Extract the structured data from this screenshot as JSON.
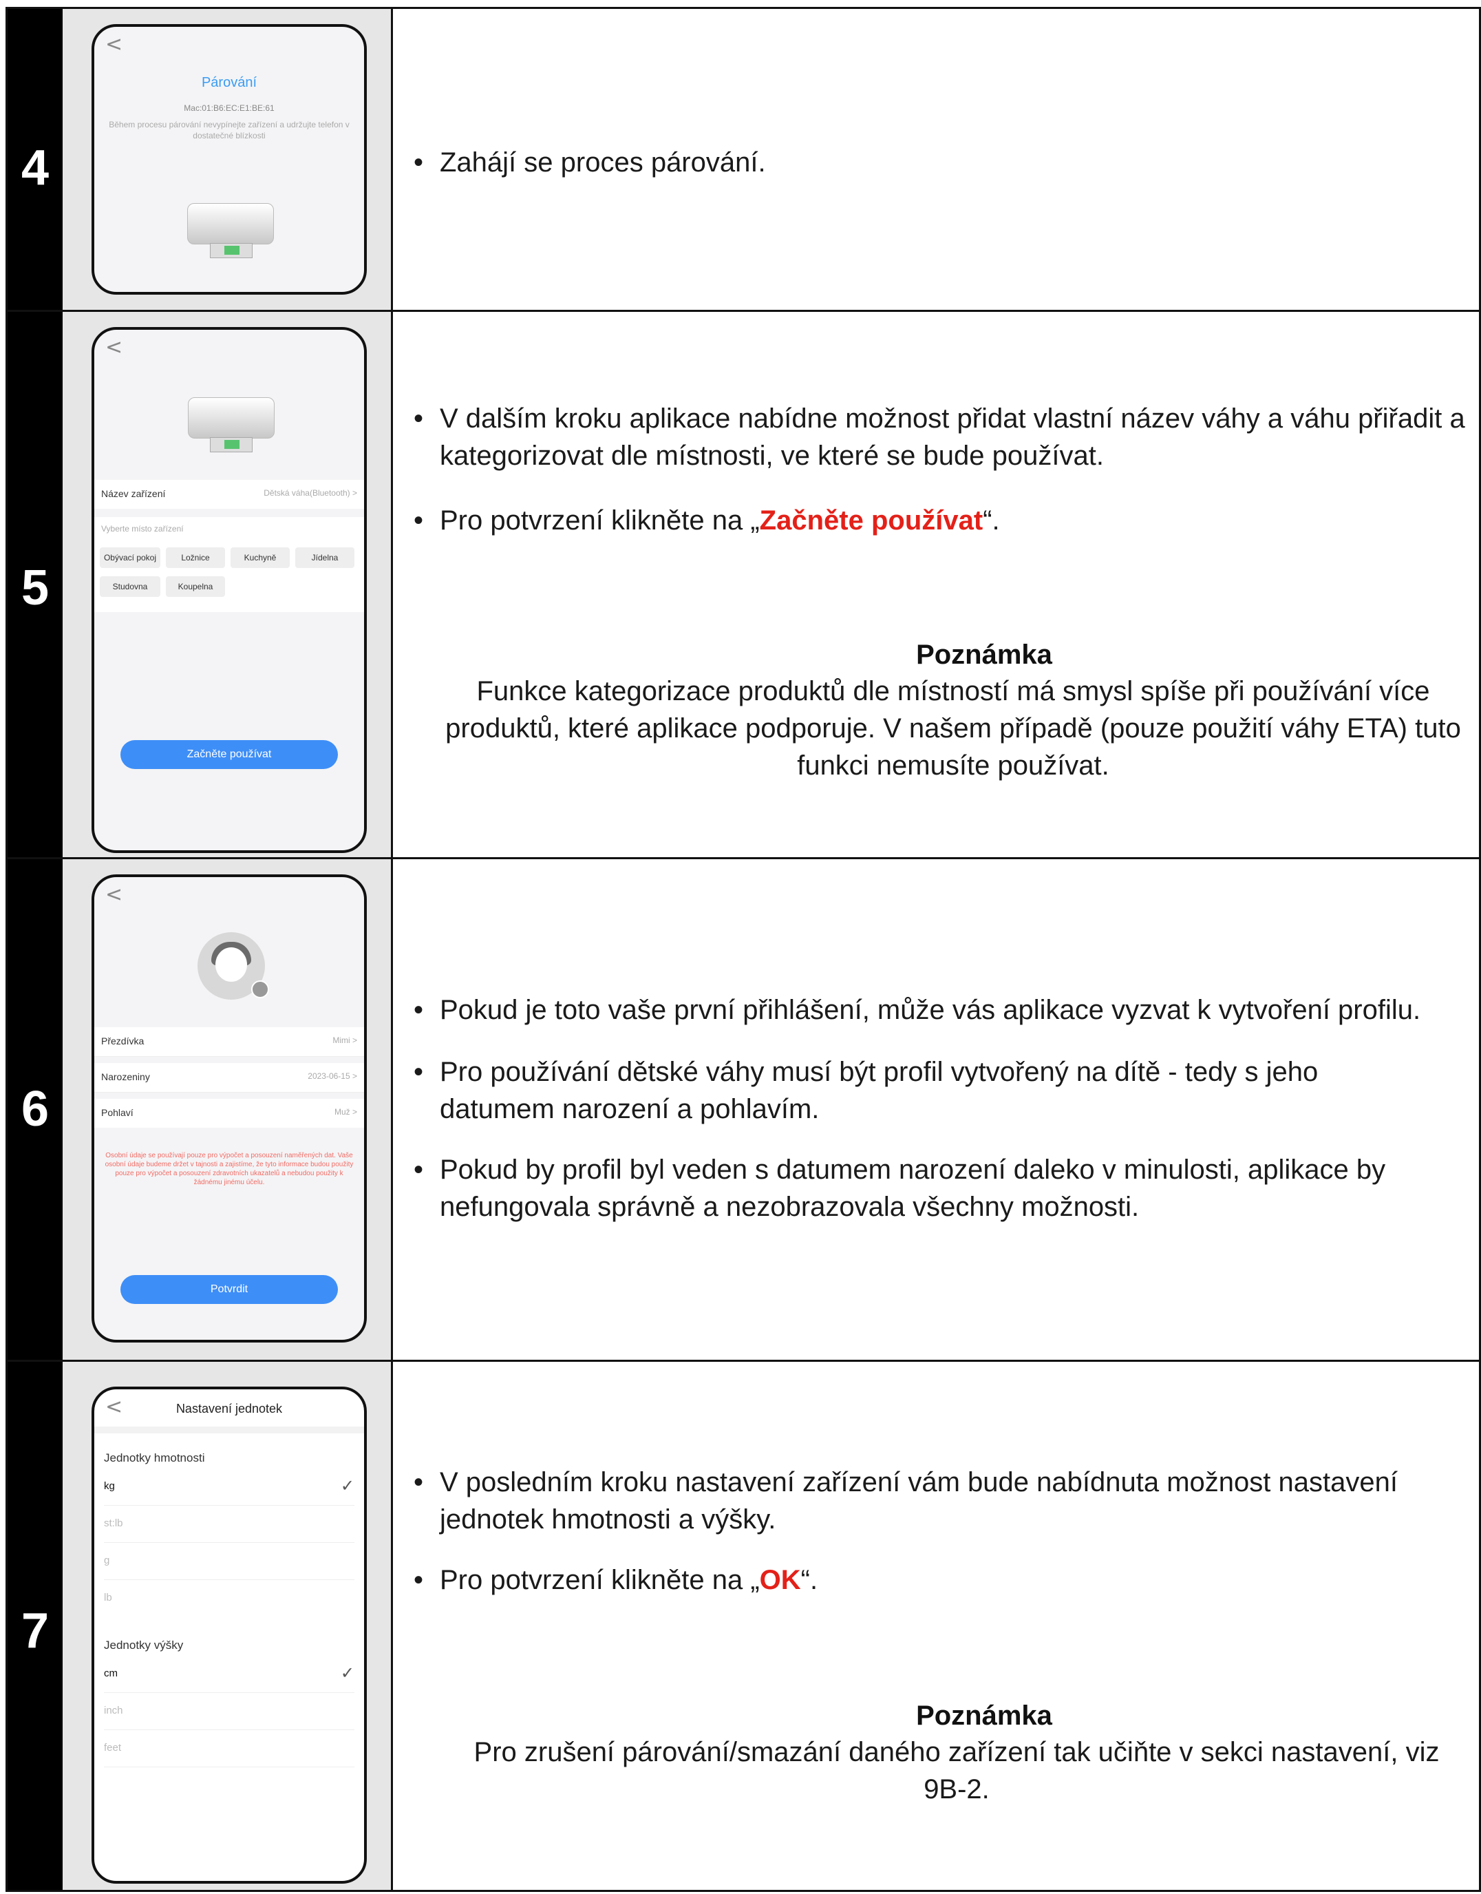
{
  "rows": [
    {
      "number": "4",
      "phone": {
        "back_icon": "<",
        "title": "Párování",
        "mac": "Mac:01:B6:EC:E1:BE:61",
        "hint": "Během procesu párování nevypínejte zařízení a udržujte telefon v dostatečné blízkosti"
      },
      "bullets": [
        "Zahájí se proces párování."
      ]
    },
    {
      "number": "5",
      "phone": {
        "back_icon": "<",
        "device_name_label": "Název zařízení",
        "device_name_value": "Dětská váha(Bluetooth) >",
        "place_prompt": "Vyberte místo zařízení",
        "rooms": [
          "Obývací pokoj",
          "Ložnice",
          "Kuchyně",
          "Jídelna",
          "Studovna",
          "Koupelna"
        ],
        "button": "Začněte používat"
      },
      "bullets": [
        "V dalším kroku aplikace nabídne možnost přidat vlastní název váhy a váhu přiřadit a kategorizovat dle místnosti, ve které se bude používat."
      ],
      "confirm_prefix": "Pro potvrzení klikněte na „",
      "confirm_highlight": "Začněte používat",
      "confirm_suffix": "“.",
      "note_title": "Poznámka",
      "note_body": "Funkce kategorizace produktů dle místností má smysl spíše při používání více produktů, které aplikace podporuje. V našem případě (pouze použití váhy ETA) tuto funkci nemusíte používat."
    },
    {
      "number": "6",
      "phone": {
        "back_icon": "<",
        "fields": [
          {
            "label": "Přezdívka",
            "value": "Mimi >"
          },
          {
            "label": "Narozeniny",
            "value": "2023-06-15 >"
          },
          {
            "label": "Pohlaví",
            "value": "Muž >"
          }
        ],
        "warning": "Osobní údaje se používají pouze pro výpočet a posouzení naměřených dat. Vaše osobní údaje budeme držet v tajnosti a zajistíme, že tyto informace budou použity pouze pro výpočet a posouzení zdravotních ukazatelů a nebudou použity k žádnému jinému účelu.",
        "button": "Potvrdit"
      },
      "bullets": [
        "Pokud je toto vaše první přihlášení, může vás aplikace vyzvat k vytvoření profilu.",
        "Pro používání dětské váhy musí být profil vytvořený na dítě - tedy s jeho datumem narození a pohlavím.",
        "Pokud by profil byl veden s datumem narození daleko v minulosti, aplikace by nefungovala správně a nezobrazovala všechny možnosti."
      ]
    },
    {
      "number": "7",
      "phone": {
        "back_icon": "<",
        "title": "Nastavení jednotek",
        "weight_header": "Jednotky hmotnosti",
        "weight_units": [
          "kg",
          "st:lb",
          "g",
          "lb"
        ],
        "height_header": "Jednotky výšky",
        "height_units": [
          "cm",
          "inch",
          "feet"
        ],
        "check_icon": "✓"
      },
      "bullets": [
        "V posledním kroku nastavení zařízení vám bude nabídnuta možnost nastavení jednotek hmotnosti a výšky."
      ],
      "confirm_prefix": "Pro potvrzení klikněte na „",
      "confirm_highlight": "OK",
      "confirm_suffix": "“.",
      "note_title": "Poznámka",
      "note_body": "Pro zrušení párování/smazání daného zařízení tak učiňte v sekci nastavení, viz 9B-2."
    }
  ],
  "bullet_char": "•",
  "colors": {
    "highlight": "#e32119",
    "app_blue": "#3e8ef7",
    "title_blue": "#3a9cf2"
  }
}
